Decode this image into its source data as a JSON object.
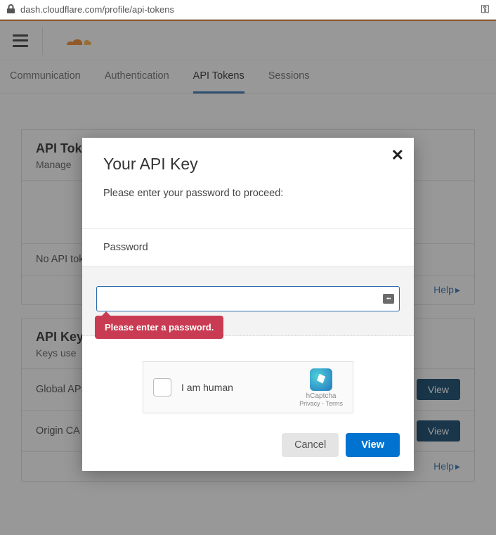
{
  "url": "dash.cloudflare.com/profile/api-tokens",
  "tabs": [
    {
      "label": "Communication",
      "active": false
    },
    {
      "label": "Authentication",
      "active": false
    },
    {
      "label": "API Tokens",
      "active": true
    },
    {
      "label": "Sessions",
      "active": false
    }
  ],
  "cards": {
    "tokens": {
      "title": "API Tokens",
      "subtitle": "Manage",
      "empty_row": "No API tokens",
      "help": "Help"
    },
    "keys": {
      "title": "API Keys",
      "subtitle": "Keys use",
      "rows": [
        {
          "label": "Global API Key",
          "action": "View"
        },
        {
          "label": "Origin CA Key",
          "action": "View"
        }
      ],
      "help": "Help"
    }
  },
  "modal": {
    "title": "Your API Key",
    "prompt": "Please enter your password to proceed:",
    "password_label": "Password",
    "password_value": "",
    "error": "Please enter a password.",
    "captcha": {
      "label": "I am human",
      "brand": "hCaptcha",
      "links": "Privacy - Terms"
    },
    "cancel": "Cancel",
    "view": "View"
  }
}
